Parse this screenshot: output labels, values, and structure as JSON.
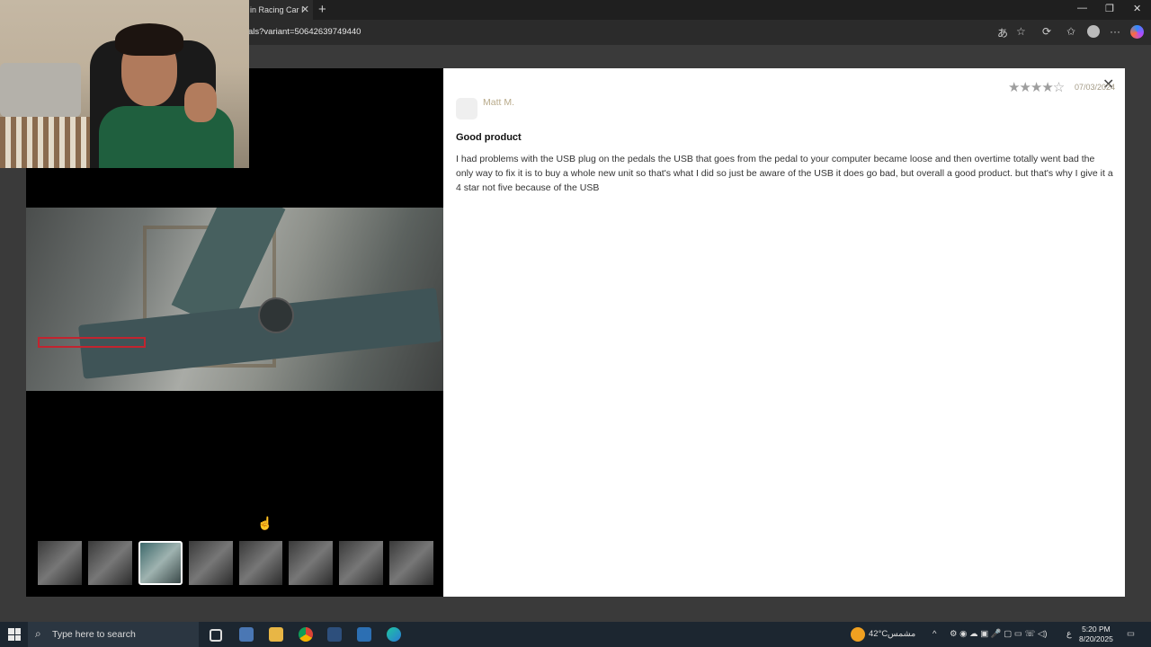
{
  "browser": {
    "tab_title": "in Racing Car I",
    "tab_close": "✕",
    "new_tab": "+",
    "url": "als?variant=50642639749440",
    "window_controls": [
      "—",
      "❐",
      "✕"
    ],
    "toolbar_icons": [
      "translate-icon",
      "favorite-star-icon",
      "extensions-icon",
      "collections-icon",
      "profile-icon",
      "more-icon",
      "copilot-icon"
    ],
    "translate_glyph": "あ",
    "star_glyph": "☆",
    "ext_glyph": "⟳",
    "fav_glyph": "✩",
    "more_glyph": "···"
  },
  "review": {
    "close_label": "✕",
    "stars": "★★★★☆",
    "rating": 4,
    "date": "07/03/2024",
    "author": "Matt M.",
    "title": "Good product",
    "body": "I had problems with the USB plug on the pedals the USB that goes from the pedal to your computer became loose and then overtime totally went bad the only way to fix it is to buy a whole new unit so that's what I did so just be aware of the USB it does go bad, but overall a good product. but that's why I give it a 4 star not five because of the USB"
  },
  "media": {
    "thumbnail_count": 8,
    "selected_thumbnail": 3
  },
  "taskbar": {
    "search_placeholder": "Type here to search",
    "weather_temp": "42°C",
    "weather_desc": "مشمس",
    "lang": "ع",
    "time": "5:20 PM",
    "date": "8/20/2025"
  }
}
